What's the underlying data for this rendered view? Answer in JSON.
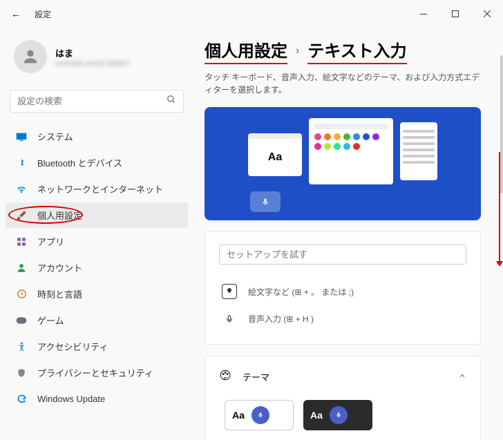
{
  "titlebar": {
    "title": "設定"
  },
  "profile": {
    "name": "はま",
    "email": "example email hidden"
  },
  "search": {
    "placeholder": "設定の検索"
  },
  "sidebar": {
    "items": [
      {
        "label": "システム",
        "icon": "system",
        "color": "#0078d4"
      },
      {
        "label": "Bluetooth とデバイス",
        "icon": "bluetooth",
        "color": "#3b82c4"
      },
      {
        "label": "ネットワークとインターネット",
        "icon": "wifi",
        "color": "#0099d8"
      },
      {
        "label": "個人用設定",
        "icon": "brush",
        "color": "#7a5c3e",
        "selected": true
      },
      {
        "label": "アプリ",
        "icon": "apps",
        "color": "#8a5ca8"
      },
      {
        "label": "アカウント",
        "icon": "account",
        "color": "#2aa05a"
      },
      {
        "label": "時刻と言語",
        "icon": "time",
        "color": "#c4913b"
      },
      {
        "label": "ゲーム",
        "icon": "game",
        "color": "#6a7080"
      },
      {
        "label": "アクセシビリティ",
        "icon": "accessibility",
        "color": "#3b8fc4"
      },
      {
        "label": "プライバシーとセキュリティ",
        "icon": "privacy",
        "color": "#888"
      },
      {
        "label": "Windows Update",
        "icon": "update",
        "color": "#0078d4"
      }
    ]
  },
  "breadcrumb": {
    "parts": [
      "個人用設定",
      "テキスト入力"
    ],
    "sep": "›"
  },
  "subtitle": "タッチ キーボード、音声入力、絵文字などのテーマ、および入力方式エディターを選択します。",
  "preview": {
    "aa": "Aa"
  },
  "setup": {
    "placeholder": "セットアップを試す",
    "emoji_label": "絵文字など (⊞ + 。 または ;)",
    "voice_label": "音声入力 (⊞ + H )"
  },
  "theme": {
    "label": "テーマ",
    "tile_aa": "Aa"
  },
  "emoji_colors": [
    "#e04a8a",
    "#e67a2e",
    "#e6b82e",
    "#4ab82e",
    "#2e8ae6",
    "#2e4ae6",
    "#8a2ee6",
    "#e62e8a",
    "#b8e62e",
    "#2ee68a",
    "#2eb8e6",
    "#e62e2e"
  ]
}
